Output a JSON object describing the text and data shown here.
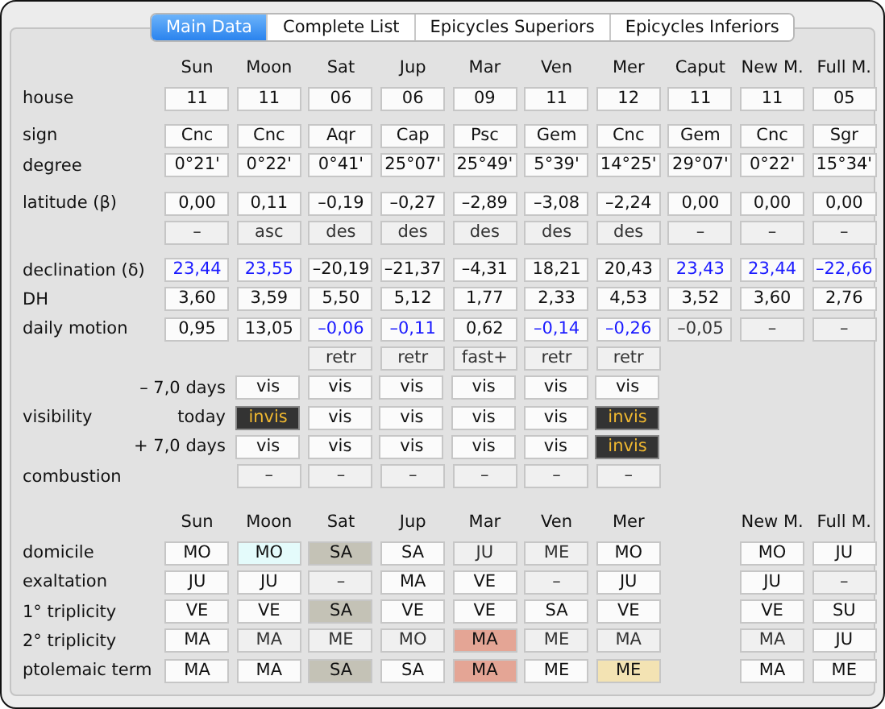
{
  "tabs": [
    {
      "label": "Main Data",
      "selected": true
    },
    {
      "label": "Complete List",
      "selected": false
    },
    {
      "label": "Epicycles Superiors",
      "selected": false
    },
    {
      "label": "Epicycles Inferiors",
      "selected": false
    }
  ],
  "tables": [
    {
      "columns": [
        "Sun",
        "Moon",
        "Sat",
        "Jup",
        "Mar",
        "Ven",
        "Mer",
        "Caput",
        "New M.",
        "Full M."
      ],
      "groups": [
        [
          {
            "label": "house",
            "cells": [
              {
                "text": "11",
                "kind": "plain"
              },
              {
                "text": "11",
                "kind": "plain"
              },
              {
                "text": "06",
                "kind": "plain"
              },
              {
                "text": "06",
                "kind": "plain"
              },
              {
                "text": "09",
                "kind": "plain"
              },
              {
                "text": "11",
                "kind": "plain"
              },
              {
                "text": "12",
                "kind": "plain"
              },
              {
                "text": "11",
                "kind": "plain"
              },
              {
                "text": "11",
                "kind": "plain"
              },
              {
                "text": "05",
                "kind": "plain"
              }
            ]
          }
        ],
        [
          {
            "label": "sign",
            "cells": [
              {
                "text": "Cnc",
                "kind": "plain"
              },
              {
                "text": "Cnc",
                "kind": "plain"
              },
              {
                "text": "Aqr",
                "kind": "plain"
              },
              {
                "text": "Cap",
                "kind": "plain"
              },
              {
                "text": "Psc",
                "kind": "plain"
              },
              {
                "text": "Gem",
                "kind": "plain"
              },
              {
                "text": "Cnc",
                "kind": "plain"
              },
              {
                "text": "Gem",
                "kind": "plain"
              },
              {
                "text": "Cnc",
                "kind": "plain"
              },
              {
                "text": "Sgr",
                "kind": "plain"
              }
            ]
          },
          {
            "label": "degree",
            "cells": [
              {
                "text": "0°21'",
                "kind": "plain"
              },
              {
                "text": "0°22'",
                "kind": "plain"
              },
              {
                "text": "0°41'",
                "kind": "plain"
              },
              {
                "text": "25°07'",
                "kind": "plain"
              },
              {
                "text": "25°49'",
                "kind": "plain"
              },
              {
                "text": "5°39'",
                "kind": "plain"
              },
              {
                "text": "14°25'",
                "kind": "plain"
              },
              {
                "text": "29°07'",
                "kind": "plain"
              },
              {
                "text": "0°22'",
                "kind": "plain"
              },
              {
                "text": "15°34'",
                "kind": "plain"
              }
            ]
          }
        ],
        [
          {
            "label": "latitude (β)",
            "cells": [
              {
                "text": "0,00",
                "kind": "plain"
              },
              {
                "text": "0,11",
                "kind": "plain"
              },
              {
                "text": "–0,19",
                "kind": "plain"
              },
              {
                "text": "–0,27",
                "kind": "plain"
              },
              {
                "text": "–2,89",
                "kind": "plain"
              },
              {
                "text": "–3,08",
                "kind": "plain"
              },
              {
                "text": "–2,24",
                "kind": "plain"
              },
              {
                "text": "0,00",
                "kind": "plain"
              },
              {
                "text": "0,00",
                "kind": "plain"
              },
              {
                "text": "0,00",
                "kind": "plain"
              }
            ]
          },
          {
            "cells": [
              {
                "text": "–",
                "kind": "dim"
              },
              {
                "text": "asc",
                "kind": "dim"
              },
              {
                "text": "des",
                "kind": "dim"
              },
              {
                "text": "des",
                "kind": "dim"
              },
              {
                "text": "des",
                "kind": "dim"
              },
              {
                "text": "des",
                "kind": "dim"
              },
              {
                "text": "des",
                "kind": "dim"
              },
              {
                "text": "–",
                "kind": "dim"
              },
              {
                "text": "–",
                "kind": "dim"
              },
              {
                "text": "–",
                "kind": "dim"
              }
            ]
          }
        ],
        [
          {
            "label": "declination (δ)",
            "cells": [
              {
                "text": "23,44",
                "kind": "blue"
              },
              {
                "text": "23,55",
                "kind": "blue"
              },
              {
                "text": "–20,19",
                "kind": "plain"
              },
              {
                "text": "–21,37",
                "kind": "plain"
              },
              {
                "text": "–4,31",
                "kind": "plain"
              },
              {
                "text": "18,21",
                "kind": "plain"
              },
              {
                "text": "20,43",
                "kind": "plain"
              },
              {
                "text": "23,43",
                "kind": "blue"
              },
              {
                "text": "23,44",
                "kind": "blue"
              },
              {
                "text": "–22,66",
                "kind": "blue"
              }
            ]
          },
          {
            "label": "DH",
            "cells": [
              {
                "text": "3,60",
                "kind": "plain"
              },
              {
                "text": "3,59",
                "kind": "plain"
              },
              {
                "text": "5,50",
                "kind": "plain"
              },
              {
                "text": "5,12",
                "kind": "plain"
              },
              {
                "text": "1,77",
                "kind": "plain"
              },
              {
                "text": "2,33",
                "kind": "plain"
              },
              {
                "text": "4,53",
                "kind": "plain"
              },
              {
                "text": "3,52",
                "kind": "plain"
              },
              {
                "text": "3,60",
                "kind": "plain"
              },
              {
                "text": "2,76",
                "kind": "plain"
              }
            ]
          },
          {
            "label": "daily motion",
            "cells": [
              {
                "text": "0,95",
                "kind": "plain"
              },
              {
                "text": "13,05",
                "kind": "plain"
              },
              {
                "text": "–0,06",
                "kind": "blue"
              },
              {
                "text": "–0,11",
                "kind": "blue"
              },
              {
                "text": "0,62",
                "kind": "plain"
              },
              {
                "text": "–0,14",
                "kind": "blue"
              },
              {
                "text": "–0,26",
                "kind": "blue"
              },
              {
                "text": "–0,05",
                "kind": "dim"
              },
              {
                "text": "–",
                "kind": "dim"
              },
              {
                "text": "–",
                "kind": "dim"
              }
            ]
          },
          {
            "cells": [
              null,
              null,
              {
                "text": "retr",
                "kind": "dim"
              },
              {
                "text": "retr",
                "kind": "dim"
              },
              {
                "text": "fast+",
                "kind": "dim"
              },
              {
                "text": "retr",
                "kind": "dim"
              },
              {
                "text": "retr",
                "kind": "dim"
              },
              null,
              null,
              null
            ]
          },
          {
            "sublabel": "– 7,0 days",
            "cells": [
              null,
              {
                "text": "vis",
                "kind": "plain"
              },
              {
                "text": "vis",
                "kind": "plain"
              },
              {
                "text": "vis",
                "kind": "plain"
              },
              {
                "text": "vis",
                "kind": "plain"
              },
              {
                "text": "vis",
                "kind": "plain"
              },
              {
                "text": "vis",
                "kind": "plain"
              },
              null,
              null,
              null
            ]
          },
          {
            "label": "visibility",
            "sublabel": "today",
            "cells": [
              null,
              {
                "text": "invis",
                "kind": "invis"
              },
              {
                "text": "vis",
                "kind": "plain"
              },
              {
                "text": "vis",
                "kind": "plain"
              },
              {
                "text": "vis",
                "kind": "plain"
              },
              {
                "text": "vis",
                "kind": "plain"
              },
              {
                "text": "invis",
                "kind": "invis"
              },
              null,
              null,
              null
            ]
          },
          {
            "sublabel": "+ 7,0 days",
            "cells": [
              null,
              {
                "text": "vis",
                "kind": "plain"
              },
              {
                "text": "vis",
                "kind": "plain"
              },
              {
                "text": "vis",
                "kind": "plain"
              },
              {
                "text": "vis",
                "kind": "plain"
              },
              {
                "text": "vis",
                "kind": "plain"
              },
              {
                "text": "invis",
                "kind": "invis"
              },
              null,
              null,
              null
            ]
          },
          {
            "label": "combustion",
            "cells": [
              null,
              {
                "text": "–",
                "kind": "dim"
              },
              {
                "text": "–",
                "kind": "dim"
              },
              {
                "text": "–",
                "kind": "dim"
              },
              {
                "text": "–",
                "kind": "dim"
              },
              {
                "text": "–",
                "kind": "dim"
              },
              {
                "text": "–",
                "kind": "dim"
              },
              null,
              null,
              null
            ]
          }
        ]
      ]
    },
    {
      "columns": [
        "Sun",
        "Moon",
        "Sat",
        "Jup",
        "Mar",
        "Ven",
        "Mer",
        null,
        "New M.",
        "Full M."
      ],
      "groups": [
        [
          {
            "label": "domicile",
            "cells": [
              {
                "text": "MO",
                "kind": "plain"
              },
              {
                "text": "MO",
                "kind": "tint",
                "color": "#e4fbfb"
              },
              {
                "text": "SA",
                "kind": "tint",
                "color": "#c4c2b6"
              },
              {
                "text": "SA",
                "kind": "plain"
              },
              {
                "text": "JU",
                "kind": "dim"
              },
              {
                "text": "ME",
                "kind": "dim"
              },
              {
                "text": "MO",
                "kind": "plain"
              },
              null,
              {
                "text": "MO",
                "kind": "plain"
              },
              {
                "text": "JU",
                "kind": "plain"
              }
            ]
          },
          {
            "label": "exaltation",
            "cells": [
              {
                "text": "JU",
                "kind": "plain"
              },
              {
                "text": "JU",
                "kind": "plain"
              },
              {
                "text": "–",
                "kind": "dim"
              },
              {
                "text": "MA",
                "kind": "plain"
              },
              {
                "text": "VE",
                "kind": "plain"
              },
              {
                "text": "–",
                "kind": "dim"
              },
              {
                "text": "JU",
                "kind": "plain"
              },
              null,
              {
                "text": "JU",
                "kind": "plain"
              },
              {
                "text": "–",
                "kind": "dim"
              }
            ]
          },
          {
            "label": "1° triplicity",
            "cells": [
              {
                "text": "VE",
                "kind": "plain"
              },
              {
                "text": "VE",
                "kind": "plain"
              },
              {
                "text": "SA",
                "kind": "tint",
                "color": "#c4c2b6"
              },
              {
                "text": "VE",
                "kind": "plain"
              },
              {
                "text": "VE",
                "kind": "plain"
              },
              {
                "text": "SA",
                "kind": "plain"
              },
              {
                "text": "VE",
                "kind": "plain"
              },
              null,
              {
                "text": "VE",
                "kind": "plain"
              },
              {
                "text": "SU",
                "kind": "plain"
              }
            ]
          },
          {
            "label": "2° triplicity",
            "cells": [
              {
                "text": "MA",
                "kind": "plain"
              },
              {
                "text": "MA",
                "kind": "dim"
              },
              {
                "text": "ME",
                "kind": "dim"
              },
              {
                "text": "MO",
                "kind": "dim"
              },
              {
                "text": "MA",
                "kind": "tint",
                "color": "#e4a595"
              },
              {
                "text": "ME",
                "kind": "dim"
              },
              {
                "text": "MA",
                "kind": "dim"
              },
              null,
              {
                "text": "MA",
                "kind": "dim"
              },
              {
                "text": "JU",
                "kind": "plain"
              }
            ]
          },
          {
            "label": "ptolemaic term",
            "cells": [
              {
                "text": "MA",
                "kind": "plain"
              },
              {
                "text": "MA",
                "kind": "plain"
              },
              {
                "text": "SA",
                "kind": "tint",
                "color": "#c4c2b6"
              },
              {
                "text": "SA",
                "kind": "plain"
              },
              {
                "text": "MA",
                "kind": "tint",
                "color": "#e4a595"
              },
              {
                "text": "ME",
                "kind": "plain"
              },
              {
                "text": "ME",
                "kind": "tint",
                "color": "#f3e3b3"
              },
              null,
              {
                "text": "MA",
                "kind": "plain"
              },
              {
                "text": "ME",
                "kind": "plain"
              }
            ]
          }
        ]
      ]
    }
  ]
}
